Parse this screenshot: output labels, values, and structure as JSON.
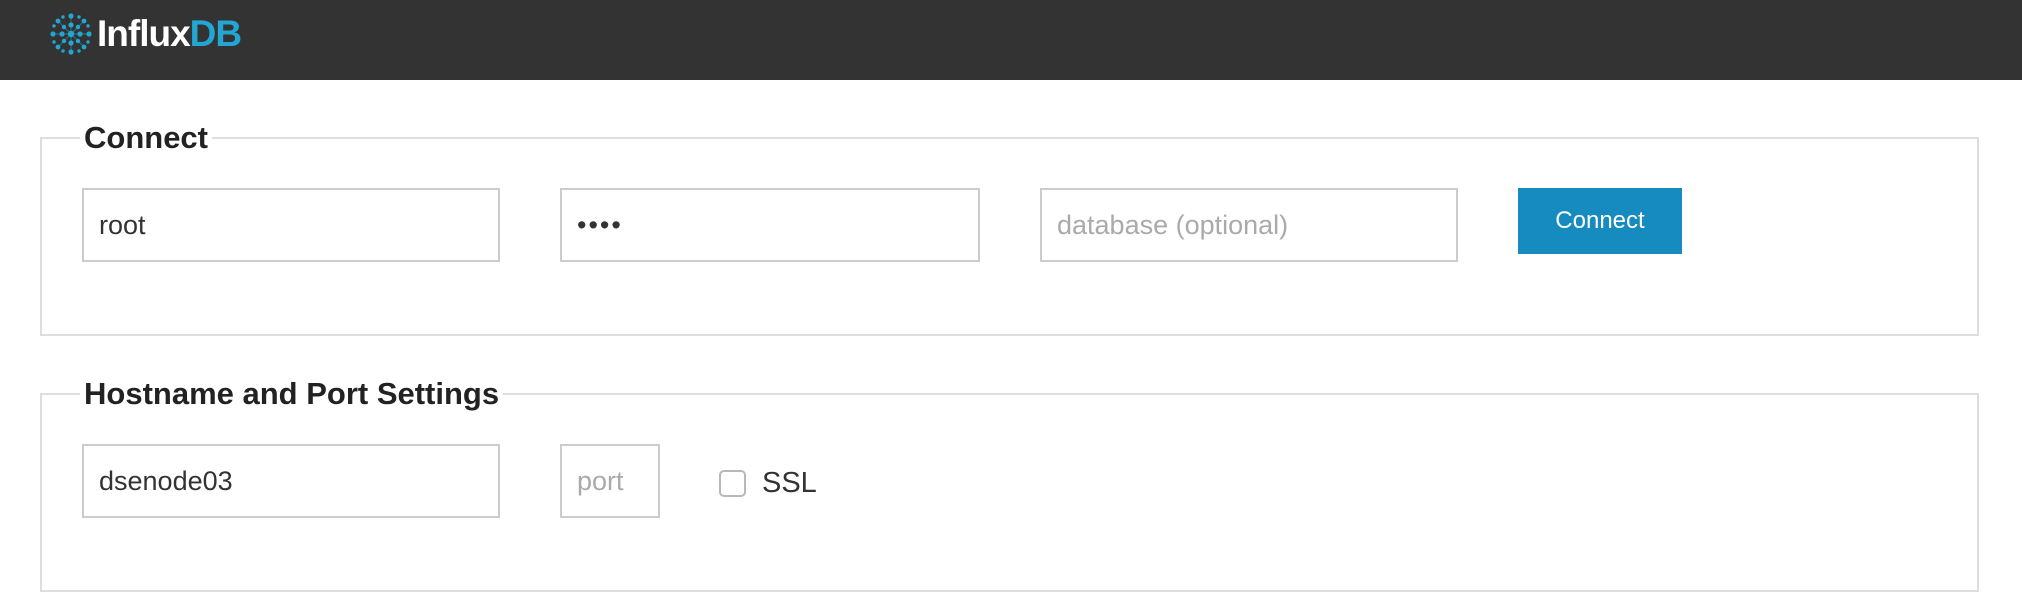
{
  "brand": {
    "name_part1": "Influx",
    "name_part2": "DB",
    "colors": {
      "topbar": "#333333",
      "accent": "#22a6d3",
      "button": "#168bbf"
    }
  },
  "connect": {
    "legend": "Connect",
    "username": {
      "value": "root"
    },
    "password": {
      "value": "root"
    },
    "database": {
      "value": "",
      "placeholder": "database (optional)"
    },
    "button_label": "Connect"
  },
  "host": {
    "legend": "Hostname and Port Settings",
    "hostname": {
      "value": "dsenode03"
    },
    "port": {
      "value": "",
      "placeholder": "port"
    },
    "ssl": {
      "label": "SSL",
      "checked": false
    }
  }
}
